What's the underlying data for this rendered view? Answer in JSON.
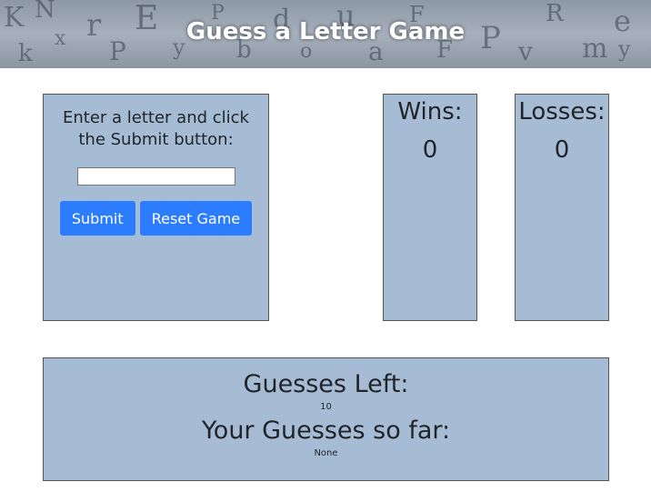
{
  "header": {
    "title": "Guess a Letter Game"
  },
  "entry": {
    "prompt": "Enter a letter and click the Submit button:",
    "input_value": "",
    "submit_label": "Submit",
    "reset_label": "Reset Game"
  },
  "wins": {
    "label": "Wins:",
    "value": "0"
  },
  "losses": {
    "label": "Losses:",
    "value": "0"
  },
  "guesses": {
    "left_label": "Guesses Left:",
    "left_value": "10",
    "so_far_label": "Your Guesses so far:",
    "so_far_value": "None"
  },
  "colors": {
    "panel": "#a6bcd4",
    "button": "#2b7cff"
  }
}
